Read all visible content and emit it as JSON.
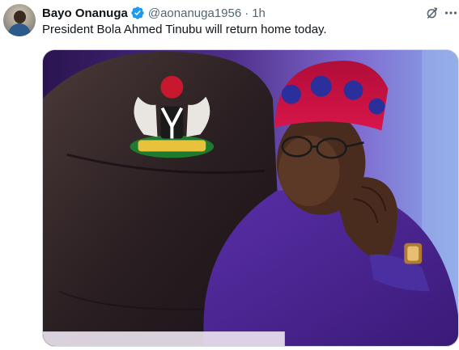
{
  "tweet": {
    "author_name": "Bayo Onanuga",
    "handle": "@aonanuga1956",
    "separator": "·",
    "time": "1h",
    "text": "President Bola Ahmed Tinubu will return home today."
  },
  "icons": {
    "verified": "verified-badge-icon",
    "grok": "grok-icon",
    "more": "more-options-icon"
  },
  "colors": {
    "verified_blue": "#1d9bf0",
    "secondary_text": "#536471",
    "cap_red": "#c8103e",
    "cap_blue": "#2a2f9c"
  }
}
